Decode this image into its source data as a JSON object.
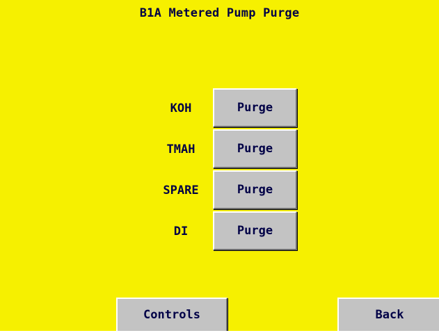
{
  "screen": {
    "title": "B1A Metered Pump Purge",
    "background_color": "#f6f000",
    "text_color": "#000046"
  },
  "purge_rows": [
    {
      "label": "KOH",
      "button_label": "Purge"
    },
    {
      "label": "TMAH",
      "button_label": "Purge"
    },
    {
      "label": "SPARE",
      "button_label": "Purge"
    },
    {
      "label": "DI",
      "button_label": "Purge"
    }
  ],
  "footer": {
    "controls_label": "Controls",
    "back_label": "Back"
  }
}
